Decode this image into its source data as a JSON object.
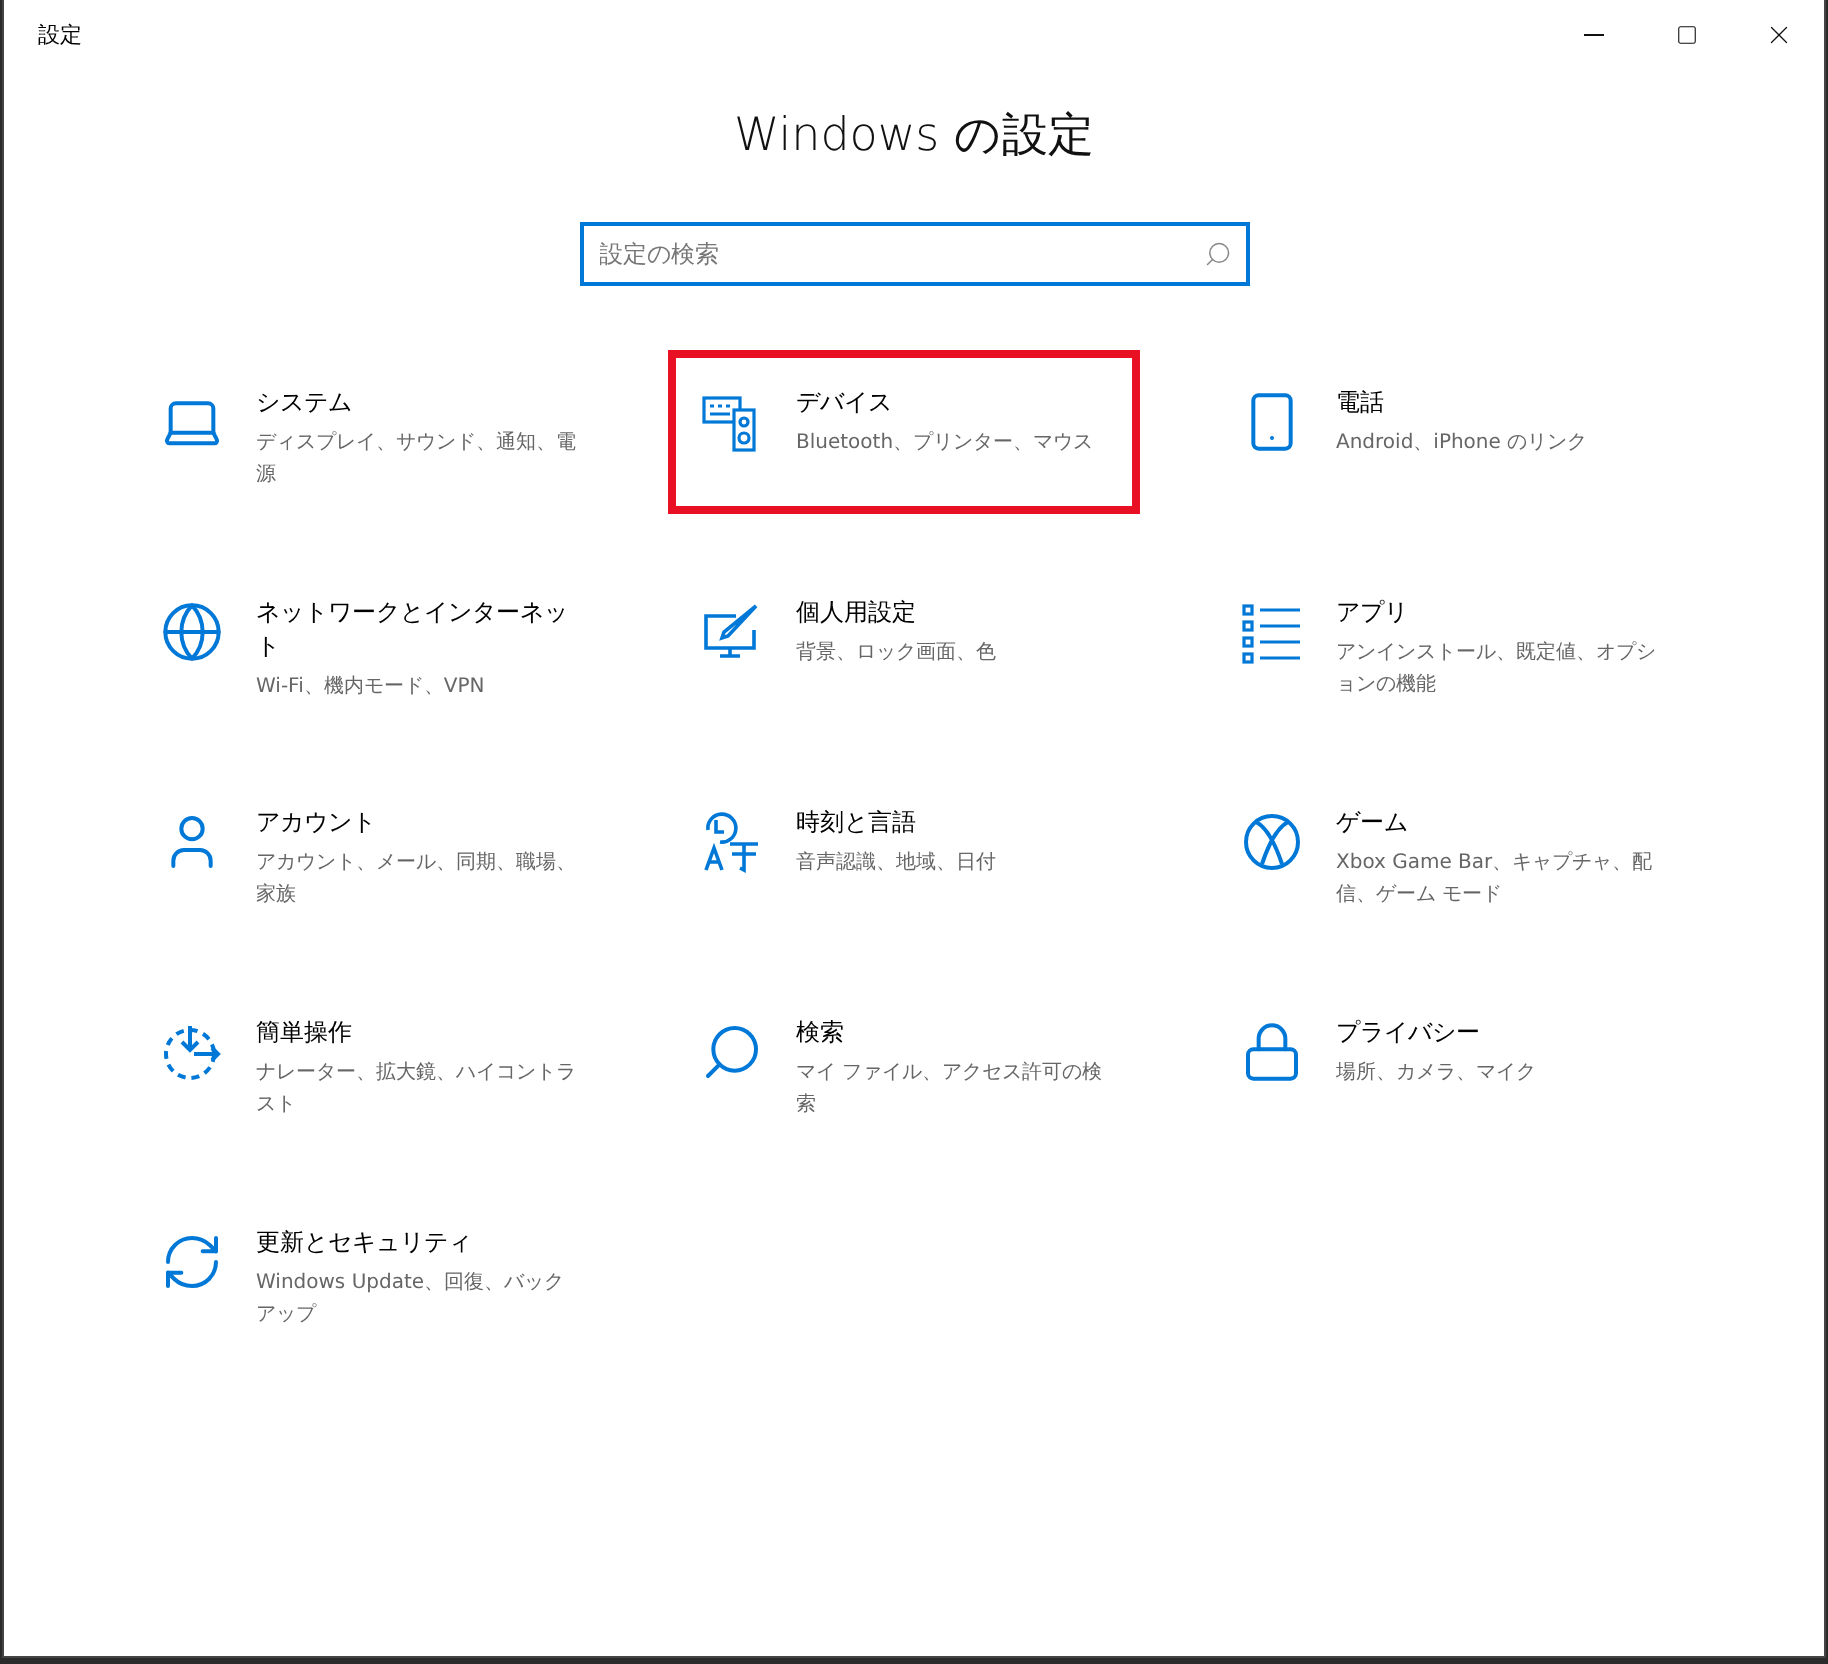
{
  "window": {
    "title": "設定"
  },
  "heading": "Windows の設定",
  "search": {
    "placeholder": "設定の検索"
  },
  "categories": [
    {
      "title": "システム",
      "description": "ディスプレイ、サウンド、通知、電源",
      "highlighted": false
    },
    {
      "title": "デバイス",
      "description": "Bluetooth、プリンター、マウス",
      "highlighted": true
    },
    {
      "title": "電話",
      "description": "Android、iPhone のリンク",
      "highlighted": false
    },
    {
      "title": "ネットワークとインターネット",
      "description": "Wi-Fi、機内モード、VPN",
      "highlighted": false
    },
    {
      "title": "個人用設定",
      "description": "背景、ロック画面、色",
      "highlighted": false
    },
    {
      "title": "アプリ",
      "description": "アンインストール、既定値、オプションの機能",
      "highlighted": false
    },
    {
      "title": "アカウント",
      "description": "アカウント、メール、同期、職場、家族",
      "highlighted": false
    },
    {
      "title": "時刻と言語",
      "description": "音声認識、地域、日付",
      "highlighted": false
    },
    {
      "title": "ゲーム",
      "description": "Xbox Game Bar、キャプチャ、配信、ゲーム モード",
      "highlighted": false
    },
    {
      "title": "簡単操作",
      "description": "ナレーター、拡大鏡、ハイコントラスト",
      "highlighted": false
    },
    {
      "title": "検索",
      "description": "マイ ファイル、アクセス許可の検索",
      "highlighted": false
    },
    {
      "title": "プライバシー",
      "description": "場所、カメラ、マイク",
      "highlighted": false
    },
    {
      "title": "更新とセキュリティ",
      "description": "Windows Update、回復、バックアップ",
      "highlighted": false
    }
  ]
}
